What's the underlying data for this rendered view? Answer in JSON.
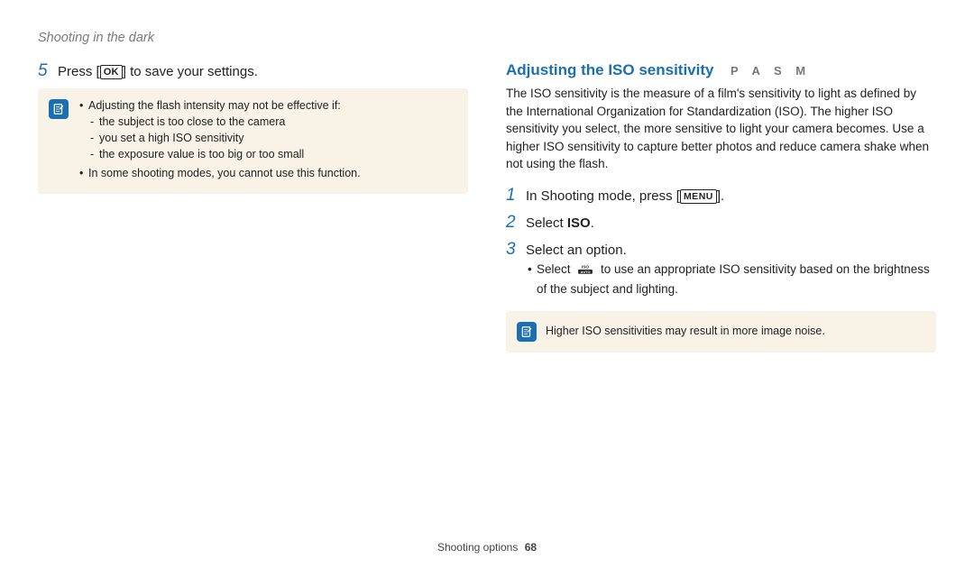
{
  "breadcrumb": "Shooting in the dark",
  "left": {
    "step5": {
      "num": "5",
      "pre": "Press [",
      "key": "OK",
      "post": "] to save your settings."
    },
    "note": {
      "line1": "Adjusting the flash intensity may not be effective if:",
      "sub": [
        "the subject is too close to the camera",
        "you set a high ISO sensitivity",
        "the exposure value is too big or too small"
      ],
      "line2": "In some shooting modes, you cannot use this function."
    }
  },
  "right": {
    "title": "Adjusting the ISO sensitivity",
    "modes": "P A S M",
    "intro": "The ISO sensitivity is the measure of a film's sensitivity to light as defined by the International Organization for Standardization (ISO). The higher ISO sensitivity you select, the more sensitive to light your camera becomes. Use a higher ISO sensitivity to capture better photos and reduce camera shake when not using the flash.",
    "step1": {
      "num": "1",
      "pre": "In Shooting mode, press [",
      "key": "MENU",
      "post": "]."
    },
    "step2": {
      "num": "2",
      "pre": "Select ",
      "strong": "ISO",
      "post": "."
    },
    "step3": {
      "num": "3",
      "text": "Select an option."
    },
    "step3sub": {
      "pre": "Select ",
      "post": " to use an appropriate ISO sensitivity based on the brightness of the subject and lighting."
    },
    "note": "Higher ISO sensitivities may result in more image noise."
  },
  "footer": {
    "section": "Shooting options",
    "page": "68"
  }
}
